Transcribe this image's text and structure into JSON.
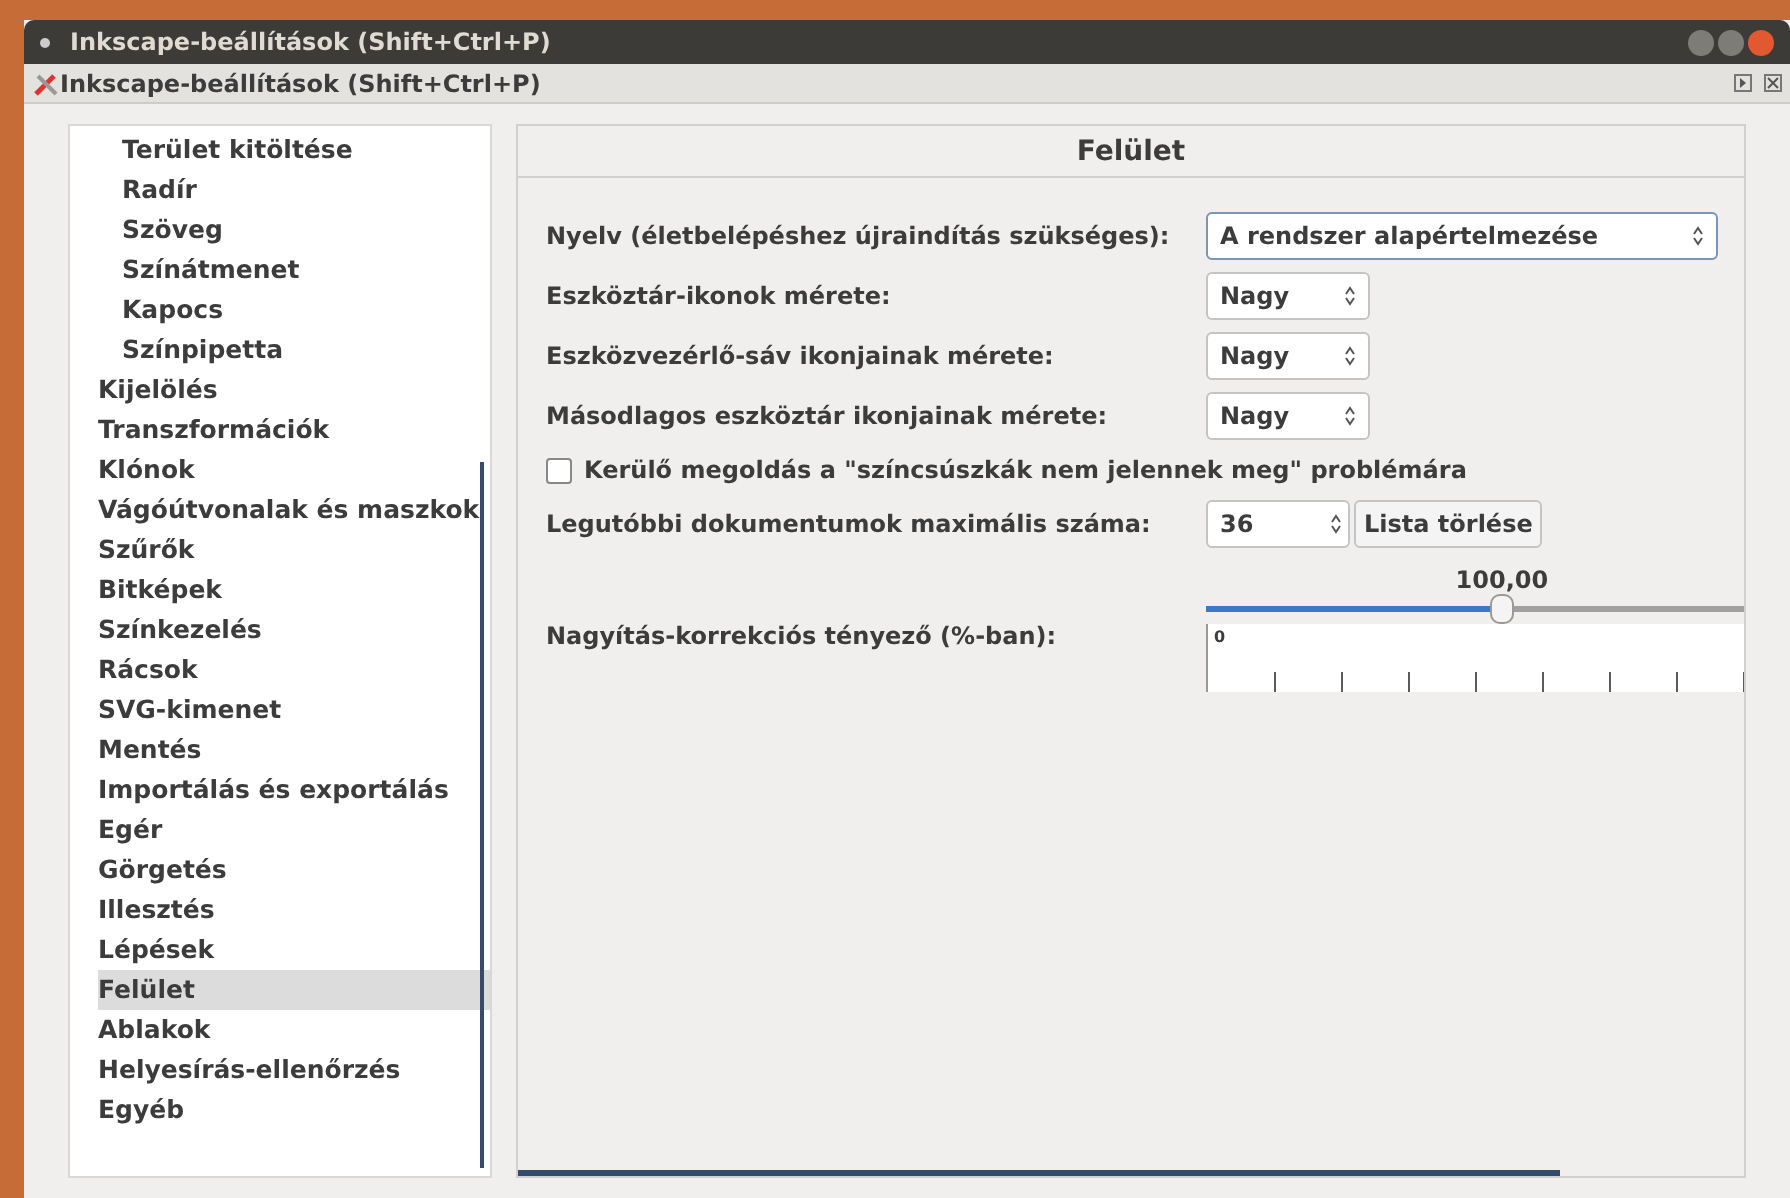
{
  "window": {
    "title": "Inkscape-beállítások (Shift+Ctrl+P)",
    "subtitle": "Inkscape-beállítások (Shift+Ctrl+P)"
  },
  "tree": [
    {
      "children": [
        {
          "label": "Terület kitöltése",
          "selected": false
        },
        {
          "label": "Radír",
          "selected": false
        },
        {
          "label": "Szöveg",
          "selected": false
        },
        {
          "label": "Színátmenet",
          "selected": false
        },
        {
          "label": "Kapocs",
          "selected": false
        },
        {
          "label": "Színpipetta",
          "selected": false
        }
      ]
    },
    {
      "label": "Kijelölés",
      "selected": false
    },
    {
      "label": "Transzformációk",
      "selected": false
    },
    {
      "label": "Klónok",
      "selected": false
    },
    {
      "label": "Vágóútvonalak és maszkok",
      "selected": false
    },
    {
      "label": "Szűrők",
      "selected": false
    },
    {
      "label": "Bitképek",
      "selected": false
    },
    {
      "label": "Színkezelés",
      "selected": false
    },
    {
      "label": "Rácsok",
      "selected": false
    },
    {
      "label": "SVG-kimenet",
      "selected": false
    },
    {
      "label": "Mentés",
      "selected": false
    },
    {
      "label": "Importálás és exportálás",
      "selected": false
    },
    {
      "label": "Egér",
      "selected": false
    },
    {
      "label": "Görgetés",
      "selected": false
    },
    {
      "label": "Illesztés",
      "selected": false
    },
    {
      "label": "Lépések",
      "selected": false
    },
    {
      "label": "Felület",
      "selected": true
    },
    {
      "label": "Ablakok",
      "selected": false
    },
    {
      "label": "Helyesírás-ellenőrzés",
      "selected": false
    },
    {
      "label": "Egyéb",
      "selected": false
    }
  ],
  "panel": {
    "title": "Felület",
    "rows": [
      {
        "kind": "combo",
        "label": "Nyelv (életbelépéshez újraindítás szükséges):",
        "value": "A rendszer alapértelmezése"
      },
      {
        "kind": "select",
        "label": "Eszköztár-ikonok mérete:",
        "value": "Nagy"
      },
      {
        "kind": "select",
        "label": "Eszközvezérlő-sáv ikonjainak mérete:",
        "value": "Nagy"
      },
      {
        "kind": "select",
        "label": "Másodlagos eszköztár ikonjainak mérete:",
        "value": "Nagy"
      },
      {
        "kind": "checkbox",
        "label": "Kerülő megoldás a \"színcsúszkák nem jelennek meg\" problémára",
        "checked": false
      },
      {
        "kind": "spin",
        "label": "Legutóbbi dokumentumok maximális száma:",
        "value": "36",
        "button": "Lista törlése"
      },
      {
        "kind": "slider",
        "label": "Nagyítás-korrekciós tényező (%-ban):",
        "reading": "100,00",
        "level": 0.55,
        "ruler_label": "0"
      }
    ]
  }
}
